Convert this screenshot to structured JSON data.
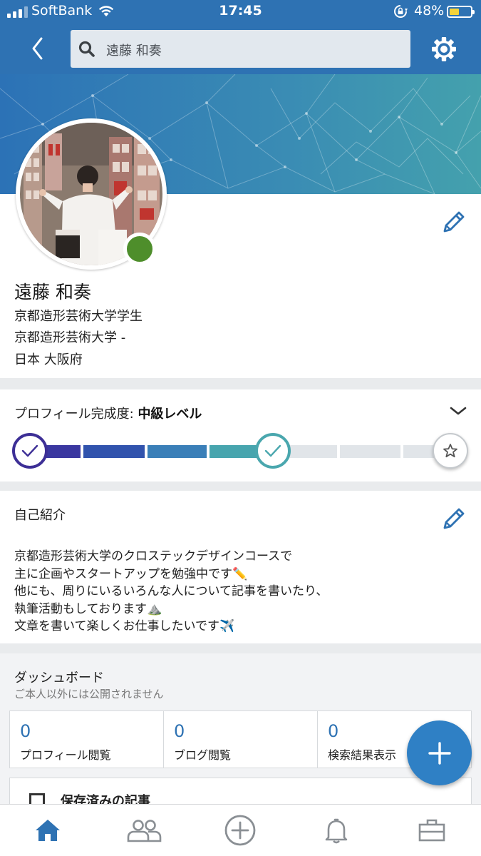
{
  "status_bar": {
    "carrier": "SoftBank",
    "time": "17:45",
    "battery_percent": "48%",
    "battery_level": 0.48,
    "icons": [
      "signal-icon",
      "wifi-icon",
      "orientation-lock-icon",
      "battery-icon"
    ]
  },
  "top_bar": {
    "search_value": "遠藤 和奏",
    "icons": [
      "back-icon",
      "search-icon",
      "gear-icon"
    ]
  },
  "profile": {
    "name": "遠藤 和奏",
    "headline": "京都造形芸術大学学生",
    "school": "京都造形芸術大学 -",
    "location": "日本 大阪府",
    "online_status_color": "#4e8e2b"
  },
  "completeness": {
    "label": "プロフィール完成度: ",
    "level": "中級レベル",
    "progress_fraction": 0.6,
    "colors": {
      "done": [
        "#3a37a0",
        "#2f63b4",
        "#3c86b8",
        "#49a9ad"
      ],
      "todo": "#e1e5e9"
    }
  },
  "about": {
    "title": "自己紹介",
    "bio_lines": [
      "京都造形芸術大学のクロステックデザインコースで",
      "主に企画やスタートアップを勉強中です✏️",
      "他にも、周りにいるいろんな人について記事を書いたり、",
      "執筆活動もしております⛰️",
      "文章を書いて楽しくお仕事したいです✈️"
    ]
  },
  "dashboard": {
    "title": "ダッシュボード",
    "subtitle": "ご本人以外には公開されません",
    "stats": [
      {
        "value": "0",
        "label": "プロフィール閲覧"
      },
      {
        "value": "0",
        "label": "ブログ閲覧"
      },
      {
        "value": "0",
        "label": "検索結果表示"
      }
    ],
    "saved_label": "保存済みの記事"
  },
  "bottom_nav": {
    "items": [
      "home-icon",
      "network-icon",
      "post-icon",
      "notifications-icon",
      "jobs-icon"
    ],
    "active_color": "#2e72b3",
    "inactive_color": "#8a8f94"
  }
}
